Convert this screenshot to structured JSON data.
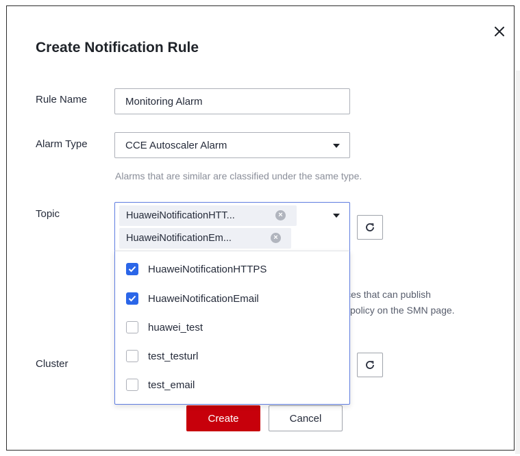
{
  "dialog": {
    "title": "Create Notification Rule",
    "close_icon": "close-icon"
  },
  "form": {
    "rule_name": {
      "label": "Rule Name",
      "value": "Monitoring Alarm"
    },
    "alarm_type": {
      "label": "Alarm Type",
      "value": "CCE Autoscaler Alarm",
      "hint": "Alarms that are similar are classified under the same type."
    },
    "topic": {
      "label": "Topic",
      "selected_tags": [
        "HuaweiNotificationHTT...",
        "HuaweiNotificationEm..."
      ],
      "options": [
        {
          "label": "HuaweiNotificationHTTPS",
          "checked": true
        },
        {
          "label": "HuaweiNotificationEmail",
          "checked": true
        },
        {
          "label": "huawei_test",
          "checked": false
        },
        {
          "label": "test_testurl",
          "checked": false
        },
        {
          "label": "test_email",
          "checked": false
        }
      ],
      "partial_hint_line1": "vices that can publish",
      "partial_hint_line2": "ic policy on the SMN page."
    },
    "cluster": {
      "label": "Cluster"
    }
  },
  "buttons": {
    "create": "Create",
    "cancel": "Cancel"
  },
  "colors": {
    "primary": "#c7000b",
    "checkbox_checked": "#2b66e8",
    "focus_border": "#5e7ce0",
    "hint_text": "#8a8e99"
  }
}
